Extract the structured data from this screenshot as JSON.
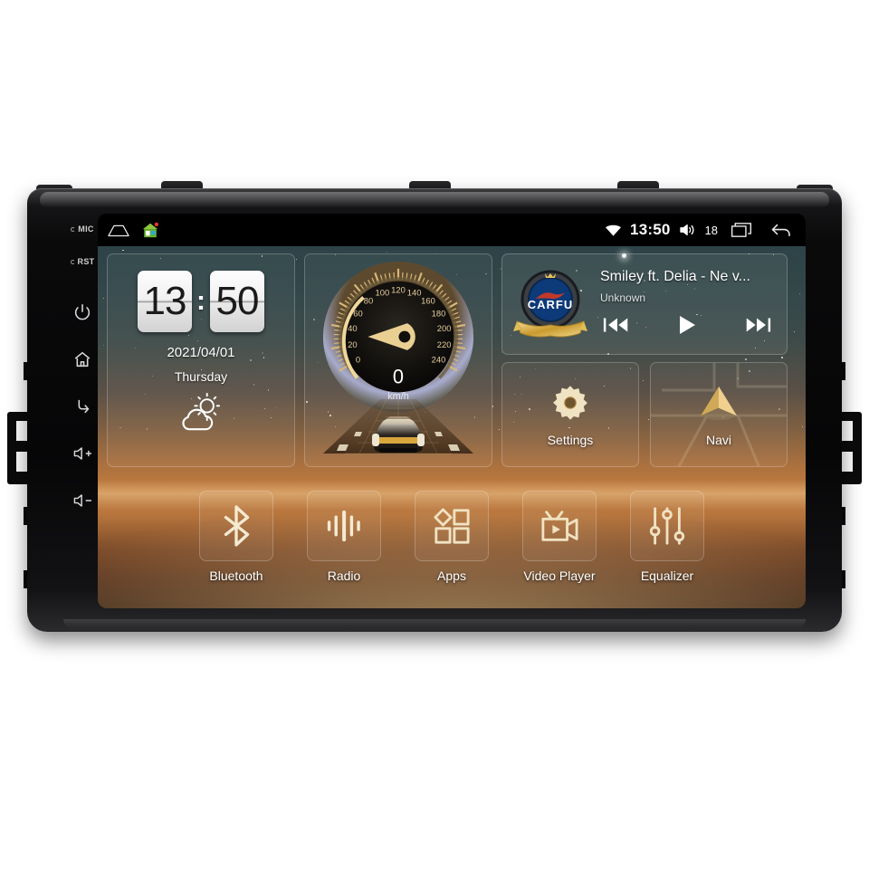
{
  "device": {
    "bezel_labels": {
      "mic": "MIC",
      "rst": "RST"
    },
    "hw_buttons": [
      {
        "name": "power",
        "icon": "power-icon"
      },
      {
        "name": "home",
        "icon": "home-icon"
      },
      {
        "name": "back",
        "icon": "back-icon"
      },
      {
        "name": "volume-up",
        "icon": "volume-up-icon"
      },
      {
        "name": "volume-down",
        "icon": "volume-down-icon"
      }
    ]
  },
  "statusbar": {
    "home_icon": "home-outline-icon",
    "app_icon": "green-house-app-icon",
    "wifi_icon": "wifi-icon",
    "time": "13:50",
    "volume_icon": "volume-icon",
    "volume_level": "18",
    "recents_icon": "recents-icon",
    "back_icon": "back-arrow-icon"
  },
  "clock_widget": {
    "hours": "13",
    "colon": ":",
    "minutes": "50",
    "date": "2021/04/01",
    "day": "Thursday",
    "weather_icon": "partly-cloudy-icon"
  },
  "speedometer": {
    "value": "0",
    "unit": "km/h",
    "ticks": [
      "0",
      "20",
      "40",
      "60",
      "80",
      "100",
      "120",
      "140",
      "160",
      "180",
      "200",
      "220",
      "240"
    ],
    "min": 0,
    "max": 240
  },
  "music": {
    "album_art_text": "CARFU",
    "track_title": "Smiley ft. Delia - Ne v...",
    "artist": "Unknown",
    "prev_label": "prev-icon",
    "play_label": "play-icon",
    "next_label": "next-icon"
  },
  "tiles": [
    {
      "id": "settings",
      "label": "Settings",
      "icon": "gear-icon"
    },
    {
      "id": "navi",
      "label": "Navi",
      "icon": "navigation-arrow-icon"
    }
  ],
  "dock": [
    {
      "id": "bluetooth",
      "label": "Bluetooth",
      "icon": "bluetooth-icon"
    },
    {
      "id": "radio",
      "label": "Radio",
      "icon": "radio-waves-icon"
    },
    {
      "id": "apps",
      "label": "Apps",
      "icon": "apps-grid-icon"
    },
    {
      "id": "video-player",
      "label": "Video Player",
      "icon": "video-camera-icon"
    },
    {
      "id": "equalizer",
      "label": "Equalizer",
      "icon": "equalizer-sliders-icon"
    }
  ],
  "colors": {
    "gold": "#e8c98a",
    "icon_cream": "#f3e4c4",
    "screen_black": "#000000",
    "sunset_orange": "#c07b3d",
    "sky_teal": "#2d4347"
  }
}
